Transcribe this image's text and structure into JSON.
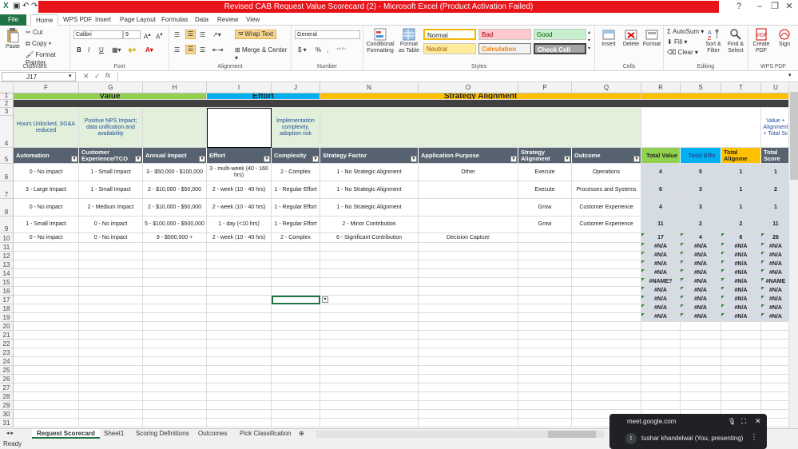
{
  "window": {
    "title": "Revised CAB Request Value Scorecard (2) - Microsoft Excel (Product Activation Failed)"
  },
  "ribbon_tabs": [
    "File",
    "Home",
    "WPS PDF",
    "Insert",
    "Page Layout",
    "Formulas",
    "Data",
    "Review",
    "View"
  ],
  "ribbon": {
    "clipboard": {
      "paste": "Paste",
      "cut": "Cut",
      "copy": "Copy",
      "format_painter": "Format Painter",
      "label": "Clipboard"
    },
    "font": {
      "name": "Calibri",
      "size": "9",
      "label": "Font",
      "bold": "B",
      "italic": "I",
      "underline": "U"
    },
    "alignment": {
      "wrap_text": "Wrap Text",
      "merge_center": "Merge & Center",
      "label": "Alignment"
    },
    "number": {
      "format": "General",
      "currency": "$",
      "percent": "%",
      "comma": ",",
      "label": "Number"
    },
    "styles": {
      "conditional": "Conditional Formatting",
      "format_table": "Format as Table",
      "normal": "Normal",
      "bad": "Bad",
      "good": "Good",
      "neutral": "Neutral",
      "calculation": "Calculation",
      "check_cell": "Check Cell",
      "label": "Styles"
    },
    "cells": {
      "insert": "Insert",
      "delete": "Delete",
      "format": "Format",
      "label": "Cells"
    },
    "editing": {
      "autosum": "AutoSum",
      "fill": "Fill",
      "clear": "Clear",
      "sort_filter": "Sort & Filter",
      "find_select": "Find & Select",
      "label": "Editing"
    },
    "wps": {
      "create_pdf": "Create PDF",
      "sign": "Sign",
      "label": "WPS PDF"
    }
  },
  "formula_bar": {
    "name_box": "J17",
    "formula": ""
  },
  "columns": [
    "F",
    "G",
    "H",
    "I",
    "J",
    "N",
    "O",
    "P",
    "Q",
    "R",
    "S",
    "T",
    "U"
  ],
  "row_numbers": [
    "1",
    "2",
    "3",
    "4",
    "5",
    "6",
    "7",
    "8",
    "9",
    "10",
    "11",
    "12",
    "13",
    "14",
    "15",
    "16",
    "17",
    "18",
    "19",
    "20",
    "21",
    "22",
    "23",
    "24",
    "25",
    "26",
    "27",
    "28",
    "29",
    "30",
    "31"
  ],
  "section_headers": {
    "value": "Value",
    "effort": "Effort",
    "strategy": "Strategy Alignment"
  },
  "descriptions": {
    "f": "Hours Unlocked, SG&A reduced",
    "g": "Positive NPS Impact; data unification and availability",
    "j": "Implementation complexity, adoption risk",
    "u": "Value + Alignment + Total Sc"
  },
  "header_row": [
    "Automation",
    "Customer Experience/TCO",
    "Annual Impact",
    "Effort",
    "Complexity",
    "Strategy Factor",
    "Application Purpose",
    "Strategy Alignment",
    "Outcome",
    "Total Value",
    "Total Effo",
    "Total Alignme",
    "Total Score"
  ],
  "data_rows": [
    [
      "0 - No impact",
      "1 - Small Impact",
      "3 - $50,000 - $100,000",
      "3 - multi-week (40 - 160 hrs)",
      "2 - Complex",
      "1 - No Strategic Alignment",
      "Other",
      "Execute",
      "Operations",
      "4",
      "5",
      "1",
      "1"
    ],
    [
      "3 - Large Impact",
      "1 - Small Impact",
      "2 - $10,000 - $50,000",
      "2 - week (10 - 40 hrs)",
      "1 - Regular Effort",
      "1 - No Strategic Alignment",
      "",
      "Execute",
      "Processes and Systems",
      "6",
      "3",
      "1",
      "2"
    ],
    [
      "0 - No impact",
      "2 - Medium Impact",
      "2 - $10,000 - $50,000",
      "2 - week (10 - 40 hrs)",
      "1 - Regular Effort",
      "1 - No Strategic Alignment",
      "",
      "Grow",
      "Customer Experience",
      "4",
      "3",
      "1",
      "1"
    ],
    [
      "1 - Small Impact",
      "0 - No impact",
      "5 - $100,000 - $500,000",
      "1 - day (<10 hrs)",
      "1 - Regular Effort",
      "2 - Minor Contribution",
      "",
      "Grow",
      "Customer Experience",
      "11",
      "2",
      "2",
      "11"
    ],
    [
      "0 - No impact",
      "0 - No impact",
      "9 - $500,000 +",
      "2 - week (10 - 40 hrs)",
      "2 - Complex",
      "6 - Significant Contribution",
      "Decision Capture",
      "",
      "",
      "17",
      "4",
      "6",
      "26"
    ]
  ],
  "na_rows": [
    [
      "#N/A",
      "#N/A",
      "#N/A",
      "#N/A"
    ],
    [
      "#N/A",
      "#N/A",
      "#N/A",
      "#N/A"
    ],
    [
      "#N/A",
      "#N/A",
      "#N/A",
      "#N/A"
    ],
    [
      "#N/A",
      "#N/A",
      "#N/A",
      "#N/A"
    ],
    [
      "#NAME?",
      "#N/A",
      "#N/A",
      "#NAME"
    ],
    [
      "#N/A",
      "#N/A",
      "#N/A",
      "#N/A"
    ],
    [
      "#N/A",
      "#N/A",
      "#N/A",
      "#N/A"
    ],
    [
      "#N/A",
      "#N/A",
      "#N/A",
      "#N/A"
    ],
    [
      "#N/A",
      "#N/A",
      "#N/A",
      "#N/A"
    ]
  ],
  "sheet_tabs": [
    "Request Scorecard",
    "Sheet1",
    "Scoring Definitions",
    "Outcomes",
    "Pick Classification"
  ],
  "status": {
    "ready": "Ready"
  },
  "meet": {
    "url": "meet.google.com",
    "presenter": "tushar khandelwal (You, presenting)",
    "avatar": "t"
  },
  "colors": {
    "excel_green": "#217346",
    "title_red": "#e8141a",
    "value_green": "#92d050",
    "effort_blue": "#00b0f0",
    "strategy_yellow": "#ffc000",
    "header_gray": "#566270"
  }
}
